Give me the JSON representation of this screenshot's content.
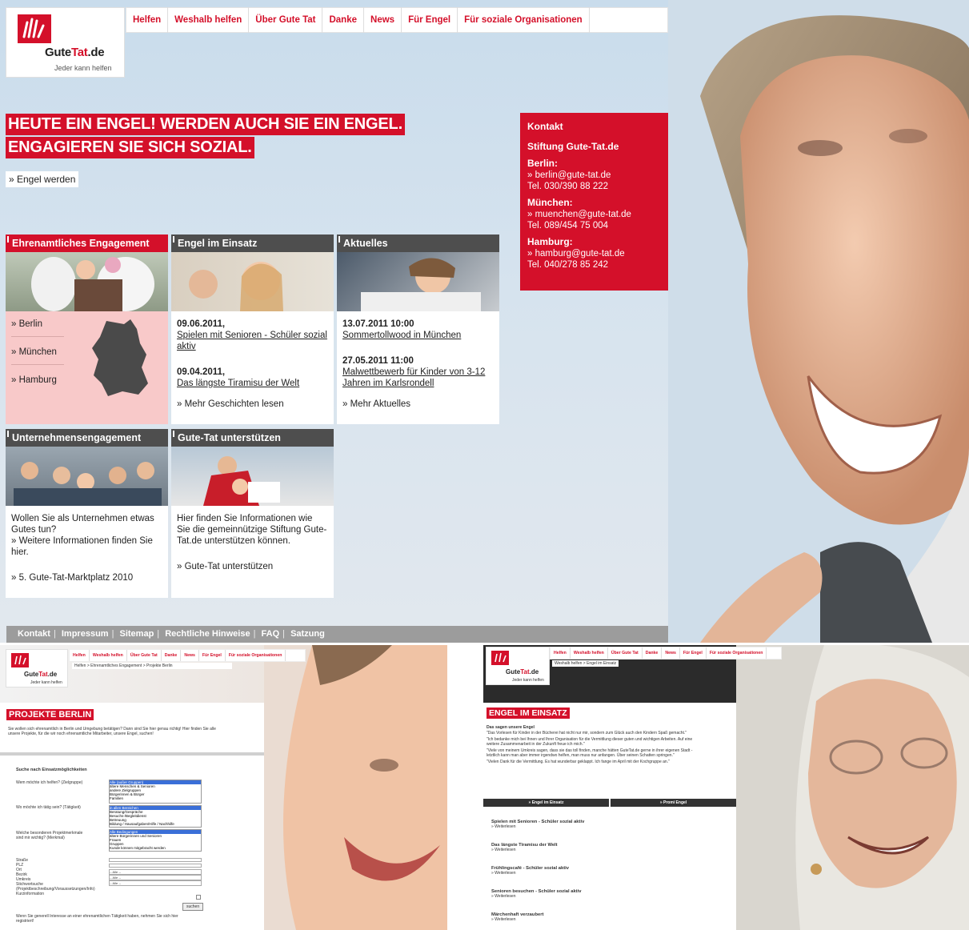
{
  "brand": {
    "name_a": "Gute",
    "name_b": "Tat",
    "name_c": ".de",
    "tagline": "Jeder kann helfen"
  },
  "nav": [
    "Helfen",
    "Weshalb helfen",
    "Über Gute Tat",
    "Danke",
    "News",
    "Für Engel",
    "Für soziale Organisationen"
  ],
  "headline": {
    "line1": "HEUTE EIN ENGEL! WERDEN AUCH SIE EIN ENGEL.",
    "line2": "ENGAGIEREN SIE SICH SOZIAL.",
    "cta": "» Engel werden"
  },
  "contact": {
    "title": "Kontakt",
    "org": "Stiftung Gute-Tat.de",
    "cities": [
      {
        "name": "Berlin:",
        "mail": "» berlin@gute-tat.de",
        "tel": "Tel. 030/390 88 222"
      },
      {
        "name": "München:",
        "mail": "» muenchen@gute-tat.de",
        "tel": "Tel. 089/454 75 004"
      },
      {
        "name": "Hamburg:",
        "mail": "» hamburg@gute-tat.de",
        "tel": "Tel. 040/278 85 242"
      }
    ]
  },
  "cards": {
    "ehren": {
      "title": "Ehrenamtliches Engagement",
      "cities": [
        "» Berlin",
        "» München",
        "» Hamburg"
      ]
    },
    "einsatz": {
      "title": "Engel im Einsatz",
      "d1": "09.06.2011,",
      "t1": "Spielen mit Senioren - Schüler sozial aktiv",
      "d2": "09.04.2011,",
      "t2": "Das längste Tiramisu der Welt",
      "more": "» Mehr Geschichten lesen"
    },
    "aktuelles": {
      "title": "Aktuelles",
      "d1": "13.07.2011 10:00",
      "t1": "Sommertollwood in München",
      "d2": "27.05.2011 11:00",
      "t2": "Malwettbewerb für Kinder von 3-12 Jahren im Karlsrondell",
      "more": "» Mehr Aktuelles"
    },
    "unternehmen": {
      "title": "Unternehmensengagement",
      "text": "Wollen Sie als Unternehmen etwas Gutes tun?",
      "link": "» Weitere Informationen finden Sie hier.",
      "link2": "» 5. Gute-Tat-Marktplatz 2010"
    },
    "unterstuetzen": {
      "title": "Gute-Tat unterstützen",
      "text": "Hier finden Sie Informationen wie Sie die gemeinnützige Stiftung Gute-Tat.de unterstützen können.",
      "link": "» Gute-Tat unterstützen"
    }
  },
  "footer": [
    "Kontakt",
    "Impressum",
    "Sitemap",
    "Rechtliche Hinweise",
    "FAQ",
    "Satzung"
  ],
  "sub1": {
    "breadcrumb": "Helfen > Ehrenamtliches Engagement > Projekte Berlin",
    "title": "PROJEKTE BERLIN",
    "intro": "Sie wollen sich ehrenamtlich in Berlin und Umgebung betätigen? Dann sind Sie hier genau richtig! Hier finden Sie alle unsere Projekte, für die wir noch ehrenamtliche Mitarbeiter, unsere Engel, suchen!",
    "search": "Suche nach Einsatzmöglichkeiten",
    "q1": "Wem möchte ich helfen? (Zielgruppe)",
    "q2": "Wo möchte ich tätig sein? (Tätigkeit)",
    "q3": "Welche besonderen Projektmerkmale sind mir wichtig? (Merkmal)",
    "opts1": [
      "Alle (außer Gruppen)",
      "ältere Menschen & Senioren",
      "andere Zielgruppen",
      "Bürgerinnen & Bürger",
      "Familien"
    ],
    "opts2": [
      "in allen Bereichen",
      "Beratung/Gespräche",
      "Besuchs-/Begleitdienst",
      "Betreuung",
      "Bildung / Hausaufgaben/Hilfe / Nachhilfe"
    ],
    "opts3": [
      "Alle Bedingungen",
      "ältere Bürgerinnen und Senioren",
      "Frauen",
      "Gruppen",
      "Kunde können mitgebracht werden"
    ],
    "fields": [
      "Straße",
      "PLZ",
      "Ort",
      "Bezirk",
      "Umkreis",
      "Stichwortsuche (Projektbeschreibung/Voraussetzungen/Info)",
      "Kurzinformation"
    ],
    "sel": "-- Alle --",
    "btn": "suchen",
    "bottom": "Wenn Sie generell Interesse an einer ehrenamtlichen Tätigkeit haben, nehmen Sie sich hier registriert!"
  },
  "sub2": {
    "breadcrumb": "Weshalb helfen > Engel im Einsatz",
    "title": "ENGEL IM EINSATZ",
    "sub": "Das sagen unsere Engel",
    "quotes": [
      "\"Das Vorlesen für Kinder in der Bücherei hat nicht nur mir, sondern zum Glück auch den Kindern Spaß gemacht.\"",
      "\"Ich bedanke mich bei Ihnen und Ihrer Organisation für die Vermittlung dieser guten und wichtigen Arbeiten. Auf eine weitere Zusammenarbeit in der Zukunft freue ich mich.\"",
      "\"Viele von meinem Umkreis sagen, dass sie das toll finden, manche hätten GuteTat.de gerne in ihrer eigenen Stadt - letztlich kann man aber immer irgendwo helfen, man muss nur anfangen. Über seinen Schatten springen.\"",
      "\"Vielen Dank für die Vermittlung. Es hat wunderbar geklappt. Ich fange im April mit der Kochgruppe an.\""
    ],
    "tabs": [
      "» Engel im Einsatz",
      "» Promi Engel"
    ],
    "stories": [
      "Spielen mit Senioren - Schüler sozial aktiv",
      "Das längste Tiramisu der Welt",
      "Frühlingscafé - Schüler sozial aktiv",
      "Senioren besuchen - Schüler sozial aktiv",
      "Märchenhaft verzaubert"
    ],
    "more": "» Weiterlesen"
  }
}
